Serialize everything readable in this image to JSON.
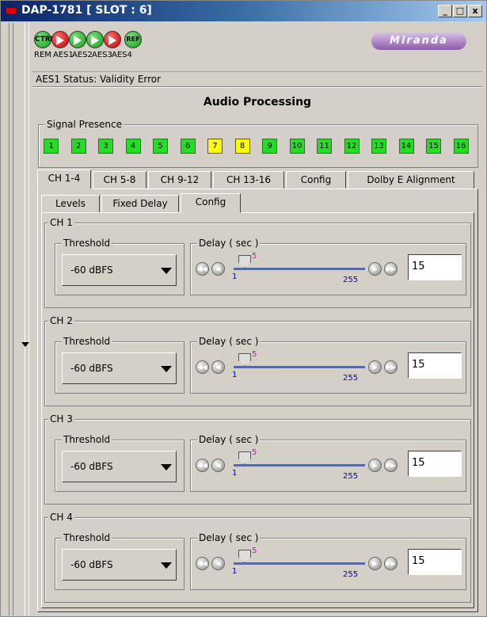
{
  "window": {
    "title": "DAP-1781 [ SLOT : 6]",
    "min_label": "_",
    "max_label": "□",
    "close_label": "x"
  },
  "header": {
    "icons": [
      {
        "name": "CTRL",
        "color": "green"
      },
      {
        "name": "AES1",
        "color": "red"
      },
      {
        "name": "AES2",
        "color": "green"
      },
      {
        "name": "AES3",
        "color": "green"
      },
      {
        "name": "AES4",
        "color": "red"
      },
      {
        "name": "REF",
        "color": "green"
      }
    ],
    "icon_labels": [
      "REM",
      "AES1",
      "AES2",
      "AES3",
      "AES4"
    ],
    "logo": "Miranda",
    "status": "AES1 Status: Validity Error"
  },
  "main": {
    "title": "Audio Processing",
    "signal_presence": {
      "label": "Signal Presence",
      "channels": [
        "1",
        "2",
        "3",
        "4",
        "5",
        "6",
        "7",
        "8",
        "9",
        "10",
        "11",
        "12",
        "13",
        "14",
        "15",
        "16"
      ],
      "warn": [
        7,
        8
      ]
    },
    "tabs": [
      "CH 1-4",
      "CH 5-8",
      "CH 9-12",
      "CH 13-16",
      "Config",
      "Dolby E Alignment"
    ],
    "selected_tab": "CH 1-4",
    "subtabs": [
      "Levels",
      "Fixed Delay",
      "Config"
    ],
    "selected_subtab": "Config",
    "channels": [
      {
        "label": "CH 1",
        "threshold_label": "Threshold",
        "threshold_value": "-60 dBFS",
        "delay_label": "Delay ( sec )",
        "min": "1",
        "max": "255",
        "cur": "5",
        "value": "15"
      },
      {
        "label": "CH 2",
        "threshold_label": "Threshold",
        "threshold_value": "-60 dBFS",
        "delay_label": "Delay ( sec )",
        "min": "1",
        "max": "255",
        "cur": "5",
        "value": "15"
      },
      {
        "label": "CH 3",
        "threshold_label": "Threshold",
        "threshold_value": "-60 dBFS",
        "delay_label": "Delay ( sec )",
        "min": "1",
        "max": "255",
        "cur": "5",
        "value": "15"
      },
      {
        "label": "CH 4",
        "threshold_label": "Threshold",
        "threshold_value": "-60 dBFS",
        "delay_label": "Delay ( sec )",
        "min": "1",
        "max": "255",
        "cur": "5",
        "value": "15"
      }
    ]
  },
  "colors": {
    "signal_ok": "#20e020",
    "signal_warn": "#ffff00",
    "min_max": "#0000d0",
    "current": "#e000e0"
  }
}
